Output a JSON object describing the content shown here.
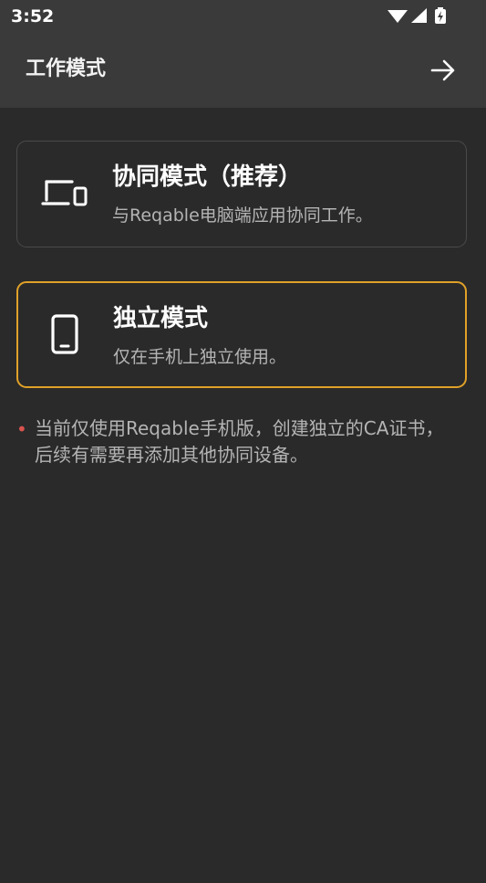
{
  "status_bar": {
    "time": "3:52",
    "icons": [
      "wifi-icon",
      "signal-icon",
      "battery-charging-icon"
    ]
  },
  "app_bar": {
    "title": "工作模式",
    "next_icon": "arrow-right-icon"
  },
  "modes": [
    {
      "id": "collaborative",
      "icon": "devices-icon",
      "title": "协同模式（推荐）",
      "subtitle": "与Reqable电脑端应用协同工作。",
      "selected": false
    },
    {
      "id": "standalone",
      "icon": "phone-icon",
      "title": "独立模式",
      "subtitle": "仅在手机上独立使用。",
      "selected": true
    }
  ],
  "note": {
    "bullet": "•",
    "text": "当前仅使用Reqable手机版，创建独立的CA证书，后续有需要再添加其他协同设备。"
  },
  "colors": {
    "background": "#2a2a2a",
    "app_bar": "#3a3a3a",
    "selected_border": "#e0a128",
    "card_border": "#4a4a4a",
    "bullet": "#d9534f",
    "subtext": "#b4b4b4"
  }
}
